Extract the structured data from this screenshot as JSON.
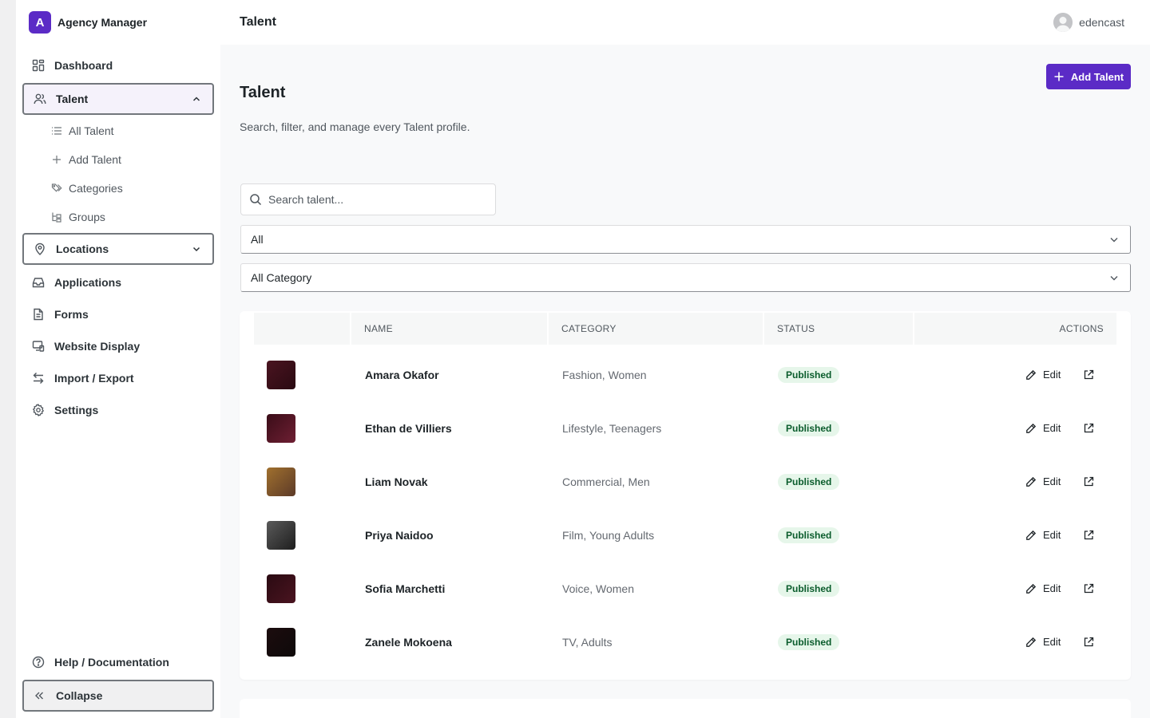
{
  "brand": {
    "logo_letter": "A",
    "name": "Agency Manager",
    "color": "#5b2bc6"
  },
  "sidebar": {
    "items": [
      {
        "label": "Dashboard",
        "icon": "grid-icon"
      },
      {
        "label": "Talent",
        "icon": "users-icon",
        "expanded": true
      },
      {
        "label": "Locations",
        "icon": "map-pin-icon"
      },
      {
        "label": "Applications",
        "icon": "inbox-icon"
      },
      {
        "label": "Forms",
        "icon": "file-icon"
      },
      {
        "label": "Website Display",
        "icon": "monitor-icon"
      },
      {
        "label": "Import / Export",
        "icon": "swap-icon"
      },
      {
        "label": "Settings",
        "icon": "gear-icon"
      }
    ],
    "talent_sub": [
      {
        "label": "All Talent",
        "icon": "list-icon"
      },
      {
        "label": "Add Talent",
        "icon": "plus-icon"
      },
      {
        "label": "Categories",
        "icon": "tags-icon"
      },
      {
        "label": "Groups",
        "icon": "tree-icon"
      }
    ],
    "help_label": "Help / Documentation",
    "collapse_label": "Collapse"
  },
  "topbar": {
    "title": "Talent",
    "username": "edencast"
  },
  "page": {
    "title": "Talent",
    "description": "Search, filter, and manage every Talent profile.",
    "add_button": "Add Talent",
    "search_placeholder": "Search talent...",
    "status_filter": "All",
    "category_filter": "All Category"
  },
  "table": {
    "columns": [
      "",
      "NAME",
      "CATEGORY",
      "STATUS",
      "ACTIONS"
    ],
    "edit_label": "Edit",
    "rows": [
      {
        "name": "Amara Okafor",
        "category": "Fashion, Women",
        "status": "Published",
        "thumb": [
          "#4a1420",
          "#2a0a12"
        ]
      },
      {
        "name": "Ethan de Villiers",
        "category": "Lifestyle, Teenagers",
        "status": "Published",
        "thumb": [
          "#3a0d18",
          "#6e1f33"
        ]
      },
      {
        "name": "Liam Novak",
        "category": "Commercial, Men",
        "status": "Published",
        "thumb": [
          "#a0702e",
          "#5c3a28"
        ]
      },
      {
        "name": "Priya Naidoo",
        "category": "Film, Young Adults",
        "status": "Published",
        "thumb": [
          "#5a5a5a",
          "#1e1e1e"
        ]
      },
      {
        "name": "Sofia Marchetti",
        "category": "Voice, Women",
        "status": "Published",
        "thumb": [
          "#2a0a12",
          "#4a1420"
        ]
      },
      {
        "name": "Zanele Mokoena",
        "category": "TV, Adults",
        "status": "Published",
        "thumb": [
          "#1c0c0e",
          "#0e0a0a"
        ]
      }
    ]
  }
}
